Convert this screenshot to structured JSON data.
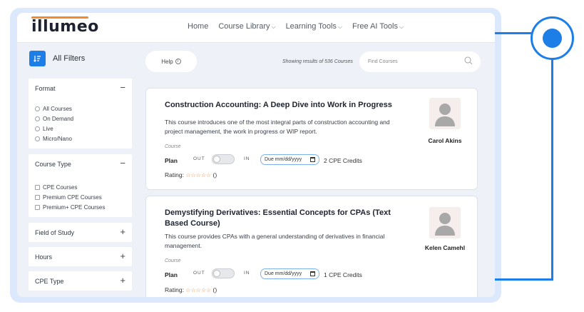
{
  "brand": {
    "logo_text": "illumeo",
    "accent": "#f28b2c",
    "primary": "#1e7ee8"
  },
  "nav": {
    "home": "Home",
    "course_library": "Course Library",
    "learning_tools": "Learning Tools",
    "free_ai_tools": "Free AI Tools",
    "chevron": "⌵"
  },
  "filters": {
    "header": "All Filters",
    "format": {
      "title": "Format",
      "toggle": "−",
      "options": [
        "All Courses",
        "On Demand",
        "Live",
        "Micro/Nano"
      ]
    },
    "course_type": {
      "title": "Course Type",
      "toggle": "−",
      "options": [
        "CPE Courses",
        "Premium CPE Courses",
        "Premium+ CPE Courses"
      ]
    },
    "field_of_study": {
      "title": "Field of Study",
      "toggle": "+"
    },
    "hours": {
      "title": "Hours",
      "toggle": "+"
    },
    "cpe_type": {
      "title": "CPE Type",
      "toggle": "+"
    }
  },
  "toolbar": {
    "help_label": "Help",
    "results_text": "Showing results of 536 Courses",
    "search_placeholder": "Find Courses"
  },
  "courses": [
    {
      "title": "Construction Accounting: A Deep Dive into Work in Progress",
      "description": "This course introduces one of the most integral parts of construction accounting and project management, the work in progress or WIP report.",
      "course_label": "Course",
      "plan_label": "Plan",
      "out_label": "OUT",
      "in_label": "IN",
      "date_placeholder": "Due mm/dd/yyyy",
      "credits": "2 CPE Credits",
      "rating_label": "Rating:",
      "stars": "☆☆☆☆☆",
      "rating_count": "()",
      "instructor": "Carol Akins"
    },
    {
      "title": "Demystifying Derivatives: Essential Concepts for CPAs (Text Based Course)",
      "description": "This course provides CPAs with a general understanding of derivatives in financial management.",
      "course_label": "Course",
      "plan_label": "Plan",
      "out_label": "OUT",
      "in_label": "IN",
      "date_placeholder": "Due mm/dd/yyyy",
      "credits": "1 CPE Credits",
      "rating_label": "Rating:",
      "stars": "☆☆☆☆☆",
      "rating_count": "()",
      "instructor": "Kelen Camehl"
    }
  ]
}
